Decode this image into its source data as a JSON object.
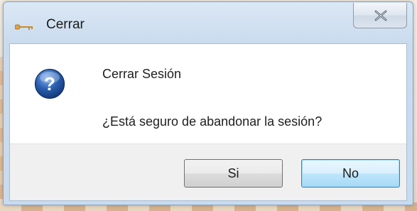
{
  "window": {
    "title": "Cerrar",
    "title_icon": "key-icon",
    "close_icon": "close-icon"
  },
  "dialog": {
    "icon": "question-icon",
    "heading": "Cerrar Sesión",
    "message": "¿Está seguro de abandonar la sesión?"
  },
  "buttons": {
    "yes_label": "Si",
    "no_label": "No"
  },
  "colors": {
    "icon_blue": "#2a5fb0",
    "default_button_border": "#3c7fb1"
  }
}
